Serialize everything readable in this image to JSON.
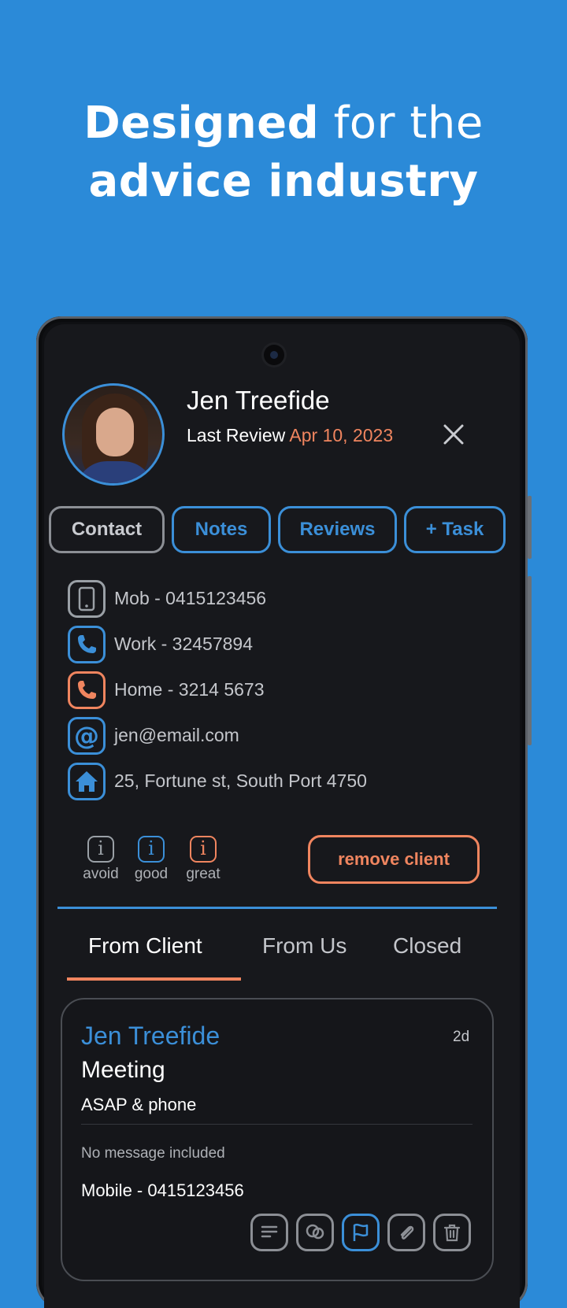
{
  "headline": {
    "line1_bold": "Designed",
    "line1_light": "for the",
    "line2_bold": "advice industry"
  },
  "client": {
    "name": "Jen Treefide",
    "review_label": "Last Review",
    "review_date": "Apr 10, 2023"
  },
  "tabs": [
    {
      "label": "Contact",
      "active": true
    },
    {
      "label": "Notes"
    },
    {
      "label": "Reviews"
    },
    {
      "label": "+ Task"
    }
  ],
  "contacts": [
    {
      "icon": "mobile-phone-icon",
      "text": "Mob - 0415123456",
      "color": "#9aa0a6"
    },
    {
      "icon": "work-phone-icon",
      "text": "Work - 32457894",
      "color": "#3b8fd8"
    },
    {
      "icon": "home-phone-icon",
      "text": "Home - 3214 5673",
      "color": "#f0855f"
    },
    {
      "icon": "email-at-icon",
      "text": "jen@email.com",
      "color": "#3b8fd8"
    },
    {
      "icon": "home-address-icon",
      "text": "25, Fortune st, South Port 4750",
      "color": "#3b8fd8"
    }
  ],
  "ratings": [
    {
      "label": "avoid",
      "color": "#9aa0a6"
    },
    {
      "label": "good",
      "color": "#3b8fd8"
    },
    {
      "label": "great",
      "color": "#f0855f"
    }
  ],
  "remove_label": "remove client",
  "segments": [
    {
      "label": "From Client",
      "active": true
    },
    {
      "label": "From Us"
    },
    {
      "label": "Closed"
    }
  ],
  "card": {
    "name": "Jen Treefide",
    "age": "2d",
    "type": "Meeting",
    "preference": "ASAP & phone",
    "message": "No message included",
    "mobile": "Mobile - 0415123456"
  },
  "colors": {
    "background": "#2b8ad8",
    "accent_blue": "#3b8fd8",
    "accent_orange": "#f0855f",
    "screen": "#17181c"
  }
}
